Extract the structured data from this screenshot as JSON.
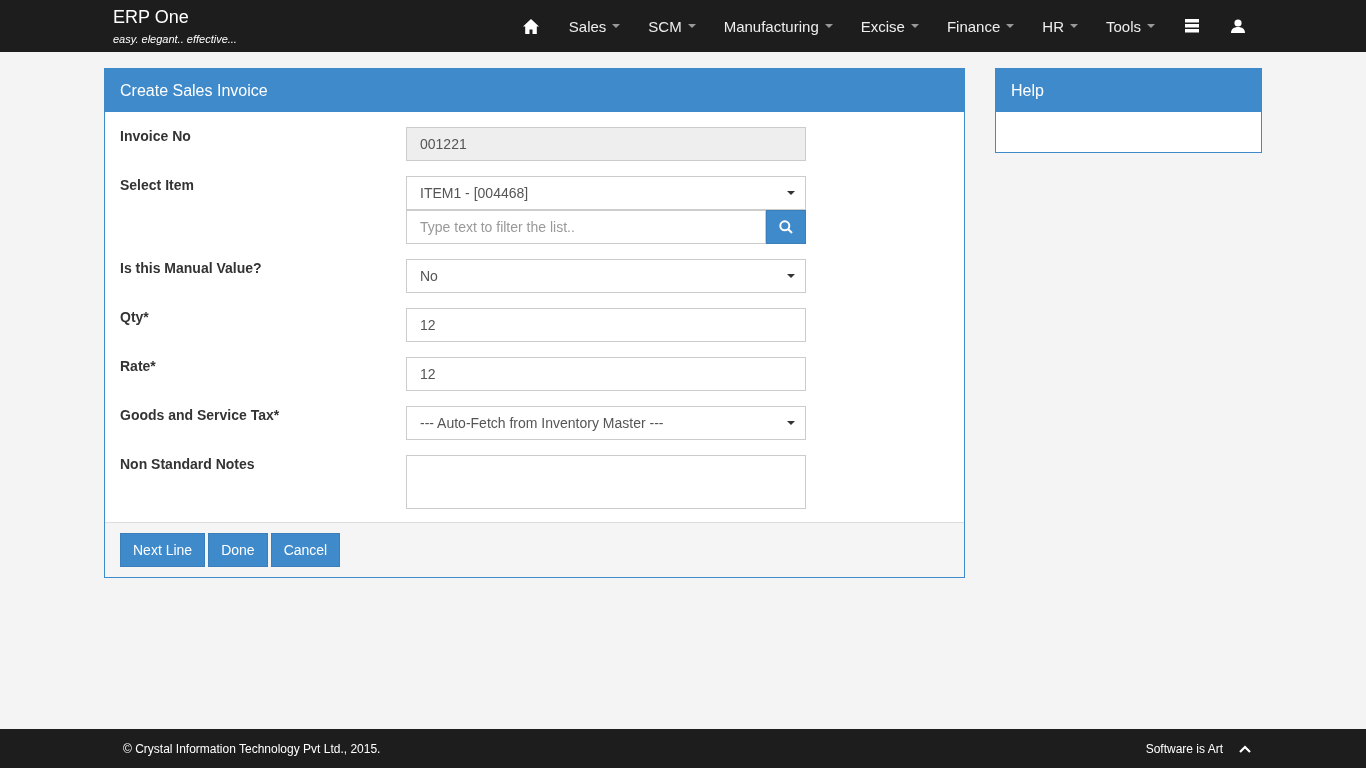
{
  "brand": {
    "title": "ERP One",
    "tagline": "easy. elegant.. effective..."
  },
  "nav": [
    {
      "kind": "home"
    },
    {
      "kind": "dropdown",
      "label": "Sales"
    },
    {
      "kind": "dropdown",
      "label": "SCM"
    },
    {
      "kind": "dropdown",
      "label": "Manufacturing"
    },
    {
      "kind": "dropdown",
      "label": "Excise"
    },
    {
      "kind": "dropdown",
      "label": "Finance"
    },
    {
      "kind": "dropdown",
      "label": "HR"
    },
    {
      "kind": "dropdown",
      "label": "Tools"
    },
    {
      "kind": "stack"
    },
    {
      "kind": "user"
    }
  ],
  "panel": {
    "title": "Create Sales Invoice",
    "fields": [
      {
        "kind": "readonly",
        "label": "Invoice No",
        "value": "001221"
      },
      {
        "kind": "select",
        "label": "Select Item",
        "value": "ITEM1 - [004468]",
        "filter_placeholder": "Type text to filter the list.."
      },
      {
        "kind": "select",
        "label": "Is this Manual Value?",
        "value": "No"
      },
      {
        "kind": "text",
        "label": "Qty*",
        "value": "12"
      },
      {
        "kind": "text",
        "label": "Rate*",
        "value": "12"
      },
      {
        "kind": "select",
        "label": "Goods and Service Tax*",
        "value": "--- Auto-Fetch from Inventory Master ---"
      },
      {
        "kind": "textarea",
        "label": "Non Standard Notes"
      }
    ],
    "buttons": [
      "Next Line",
      "Done",
      "Cancel"
    ]
  },
  "help": {
    "title": "Help"
  },
  "footer": {
    "copyright": "© Crystal Information Technology Pvt Ltd., 2015.",
    "slogan": "Software is Art"
  }
}
